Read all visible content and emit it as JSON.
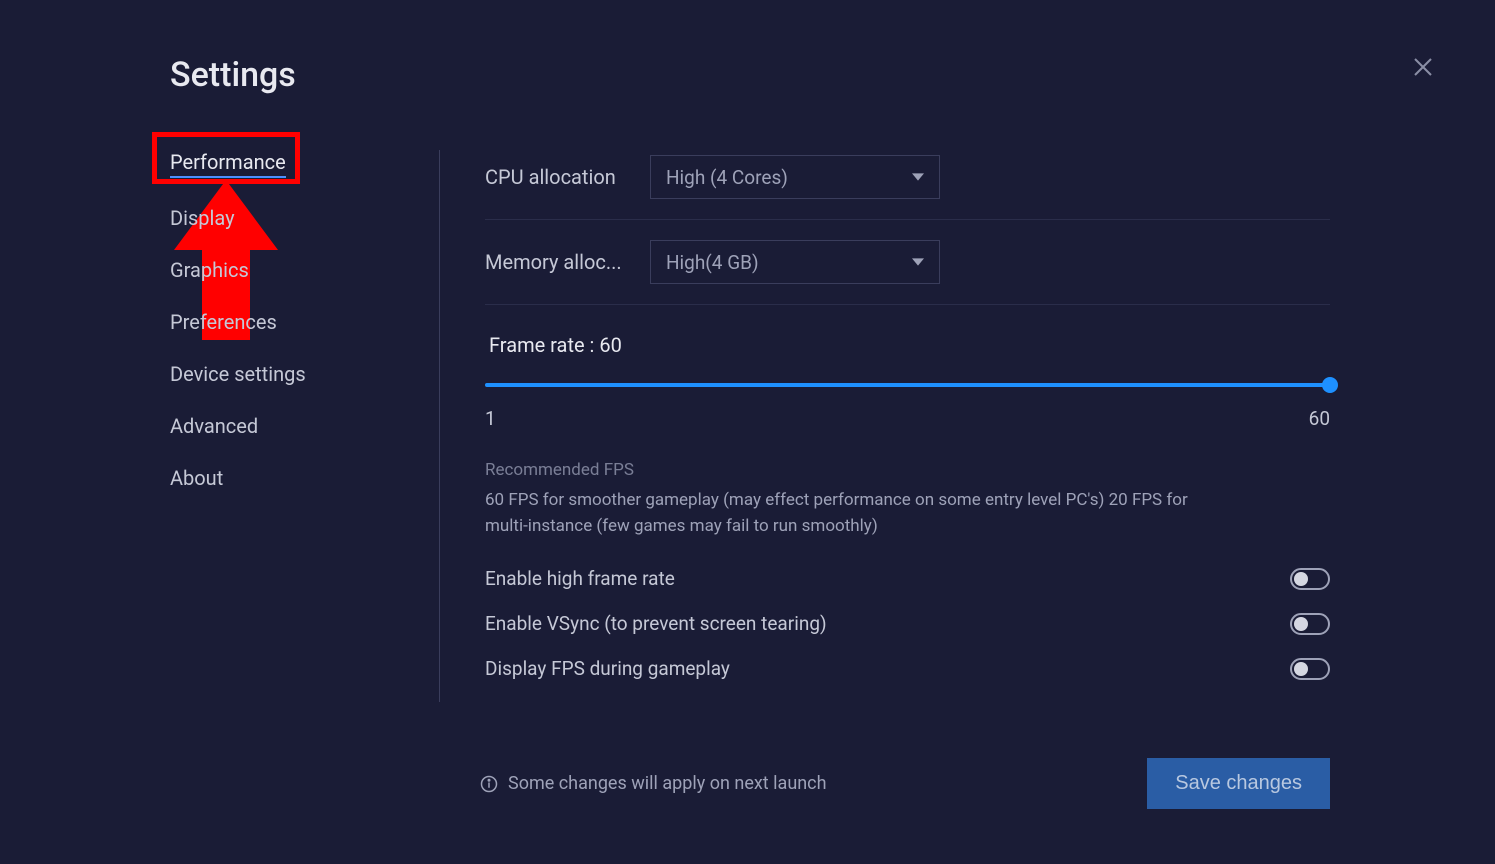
{
  "title": "Settings",
  "sidebar": {
    "items": [
      {
        "label": "Performance",
        "active": true
      },
      {
        "label": "Display",
        "active": false
      },
      {
        "label": "Graphics",
        "active": false
      },
      {
        "label": "Preferences",
        "active": false
      },
      {
        "label": "Device settings",
        "active": false
      },
      {
        "label": "Advanced",
        "active": false
      },
      {
        "label": "About",
        "active": false
      }
    ]
  },
  "settings": {
    "cpu": {
      "label": "CPU allocation",
      "value": "High (4 Cores)"
    },
    "memory": {
      "label": "Memory alloc...",
      "value": "High(4 GB)"
    },
    "frameRate": {
      "label": "Frame rate : 60",
      "min": "1",
      "max": "60"
    },
    "fpsInfo": {
      "title": "Recommended FPS",
      "text": "60 FPS for smoother gameplay (may effect performance on some entry level PC's) 20 FPS for multi-instance (few games may fail to run smoothly)"
    },
    "toggles": [
      {
        "label": "Enable high frame rate"
      },
      {
        "label": "Enable VSync (to prevent screen tearing)"
      },
      {
        "label": "Display FPS during gameplay"
      }
    ]
  },
  "footer": {
    "info": "Some changes will apply on next launch",
    "saveButton": "Save changes"
  }
}
